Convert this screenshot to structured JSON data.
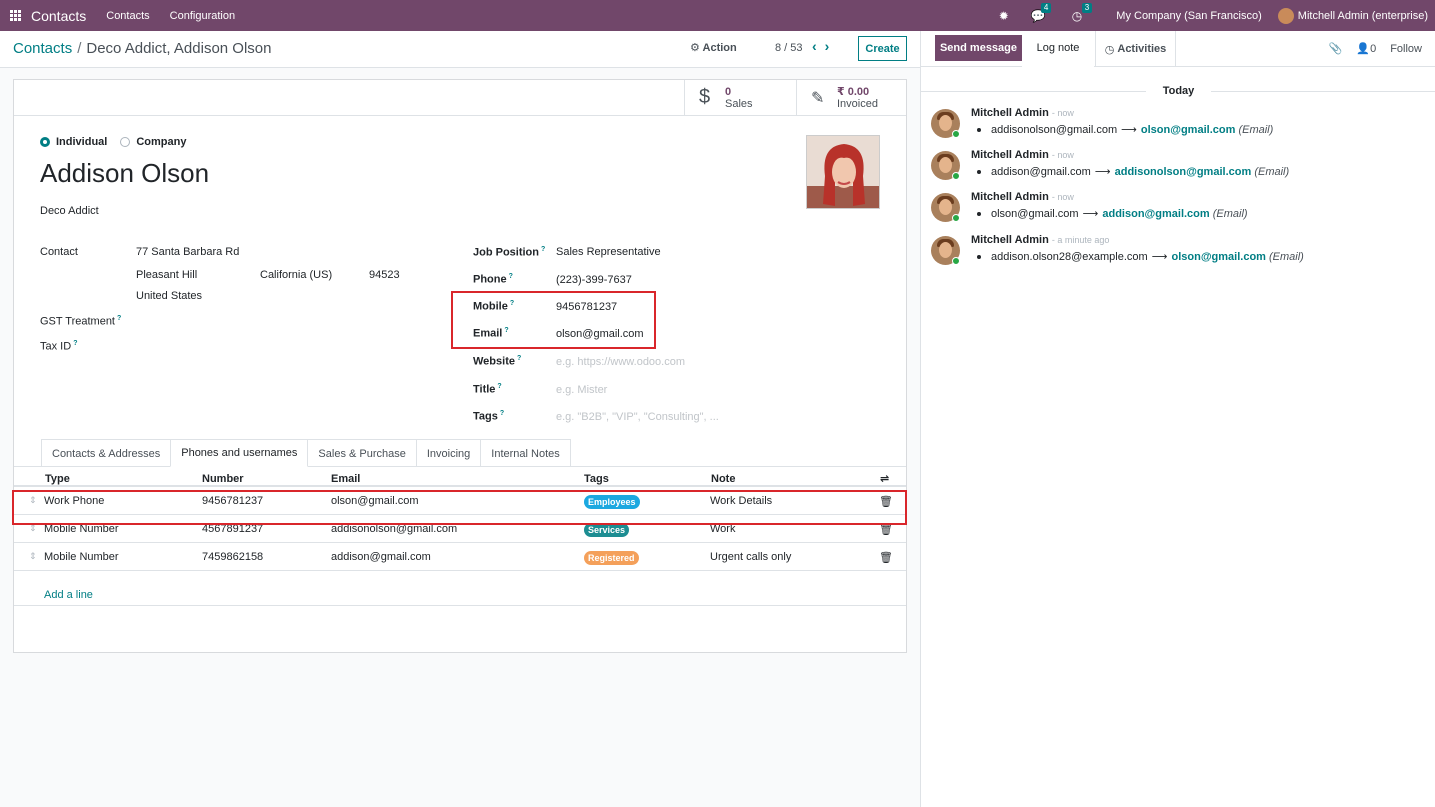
{
  "navbar": {
    "app_name": "Contacts",
    "menu": [
      "Contacts",
      "Configuration"
    ],
    "messages_badge": "4",
    "activities_badge": "3",
    "company": "My Company (San Francisco)",
    "user": "Mitchell Admin (enterprise)"
  },
  "control": {
    "breadcrumb_root": "Contacts",
    "breadcrumb_sep": "/",
    "breadcrumb_current": "Deco Addict, Addison Olson",
    "action_label": "Action",
    "pager": "8 / 53",
    "create_label": "Create"
  },
  "stats": {
    "sales_value": "0",
    "sales_label": "Sales",
    "invoiced_value": "₹ 0.00",
    "invoiced_label": "Invoiced"
  },
  "form": {
    "type_individual": "Individual",
    "type_company": "Company",
    "name": "Addison Olson",
    "parent": "Deco Addict",
    "contact_label": "Contact",
    "street": "77 Santa Barbara Rd",
    "city": "Pleasant Hill",
    "state": "California (US)",
    "zip": "94523",
    "country": "United States",
    "gst_label": "GST Treatment",
    "taxid_label": "Tax ID",
    "help_mark": "?",
    "job_label": "Job Position",
    "job_value": "Sales Representative",
    "phone_label": "Phone",
    "phone_value": "(223)-399-7637",
    "mobile_label": "Mobile",
    "mobile_value": "9456781237",
    "email_label": "Email",
    "email_value": "olson@gmail.com",
    "website_label": "Website",
    "website_placeholder": "e.g. https://www.odoo.com",
    "title_label": "Title",
    "title_placeholder": "e.g. Mister",
    "tags_label": "Tags",
    "tags_placeholder": "e.g. \"B2B\", \"VIP\", \"Consulting\", ..."
  },
  "tabs": [
    "Contacts & Addresses",
    "Phones and usernames",
    "Sales & Purchase",
    "Invoicing",
    "Internal Notes"
  ],
  "table": {
    "headers": [
      "Type",
      "Number",
      "Email",
      "Tags",
      "Note"
    ],
    "rows": [
      {
        "type": "Work Phone",
        "number": "9456781237",
        "email": "olson@gmail.com",
        "tag": "Employees",
        "tag_color": "#1ba8e0",
        "note": "Work Details"
      },
      {
        "type": "Mobile Number",
        "number": "4567891237",
        "email": "addisonolson@gmail.com",
        "tag": "Services",
        "tag_color": "#1c8d92",
        "note": "Work"
      },
      {
        "type": "Mobile Number",
        "number": "7459862158",
        "email": "addison@gmail.com",
        "tag": "Registered",
        "tag_color": "#f4a05a",
        "note": "Urgent calls only"
      }
    ],
    "add_line": "Add a line"
  },
  "chatter": {
    "send_message": "Send message",
    "log_note": "Log note",
    "activities": "Activities",
    "followers_count": "0",
    "follow": "Follow",
    "today": "Today",
    "messages": [
      {
        "author": "Mitchell Admin",
        "time": "- now",
        "old": "addisonolson@gmail.com",
        "new": "olson@gmail.com",
        "field": "(Email)"
      },
      {
        "author": "Mitchell Admin",
        "time": "- now",
        "old": "addison@gmail.com",
        "new": "addisonolson@gmail.com",
        "field": "(Email)"
      },
      {
        "author": "Mitchell Admin",
        "time": "- now",
        "old": "olson@gmail.com",
        "new": "addison@gmail.com",
        "field": "(Email)"
      },
      {
        "author": "Mitchell Admin",
        "time": "- a minute ago",
        "old": "addison.olson28@example.com",
        "new": "olson@gmail.com",
        "field": "(Email)"
      }
    ]
  },
  "colors": {
    "brand": "#71476a",
    "accent": "#017e84",
    "highlight": "#d9262b"
  }
}
